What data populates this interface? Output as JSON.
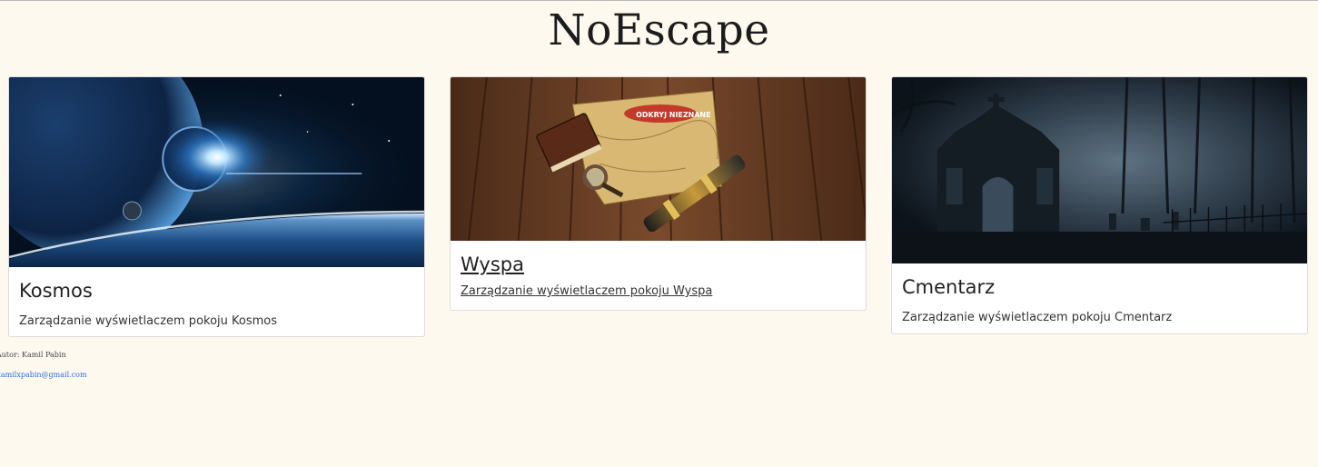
{
  "site": {
    "title": "NoEscape"
  },
  "rooms": [
    {
      "title": "Kosmos",
      "description": "Zarządzanie wyświetlaczem pokoju Kosmos",
      "image": "space-planet-image"
    },
    {
      "title": "Wyspa",
      "description": "Zarządzanie wyświetlaczem pokoju Wyspa",
      "image": "treasure-map-image",
      "map_label": "ODKRYJ NIEZNANE"
    },
    {
      "title": "Cmentarz",
      "description": "Zarządzanie wyświetlaczem pokoju Cmentarz",
      "image": "graveyard-crypt-image"
    }
  ],
  "footer": {
    "author": "Autor: Kamil Pabin",
    "email": "kamilxpabin@gmail.com"
  },
  "colors": {
    "page_background": "#fdf9ef",
    "card_background": "#ffffff",
    "link": "#2a6fd6"
  }
}
